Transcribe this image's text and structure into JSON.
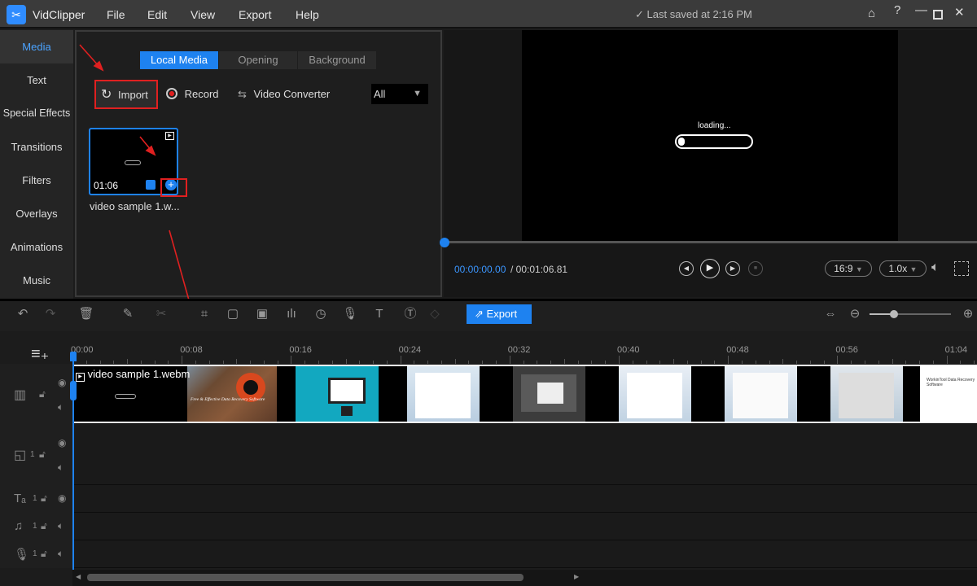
{
  "app": {
    "title": "VidClipper",
    "menu": [
      "File",
      "Edit",
      "View",
      "Export",
      "Help"
    ],
    "saved": "✓ Last saved at 2:16 PM"
  },
  "sidebar": {
    "items": [
      "Media",
      "Text",
      "Special Effects",
      "Transitions",
      "Filters",
      "Overlays",
      "Animations",
      "Music"
    ],
    "active": "Media"
  },
  "media": {
    "tabs": [
      "Local Media",
      "Opening",
      "Background"
    ],
    "import": "Import",
    "record": "Record",
    "converter": "Video Converter",
    "filter": "All",
    "item": {
      "duration": "01:06",
      "name": "video sample 1.w..."
    }
  },
  "preview": {
    "loading": "loading...",
    "current": "00:00:00.00",
    "total": "/ 00:01:06.81",
    "ratio": "16:9",
    "speed": "1.0x",
    "progress": 0
  },
  "toolbar": {
    "export": "Export",
    "zoom_level": 0.3
  },
  "timeline": {
    "ticks": [
      "00:00",
      "00:08",
      "00:16",
      "00:24",
      "00:32",
      "00:40",
      "00:48",
      "00:56",
      "01:04"
    ],
    "clip": "video sample 1.webm",
    "track_nums": [
      "1",
      "1",
      "1",
      "1"
    ],
    "thumb_text": "Free & Effective Data Recovery Software",
    "thumb_text2": "WorkinTool Data Recovery Software"
  },
  "colors": {
    "accent": "#1e82f0",
    "annotation": "#e02020"
  }
}
